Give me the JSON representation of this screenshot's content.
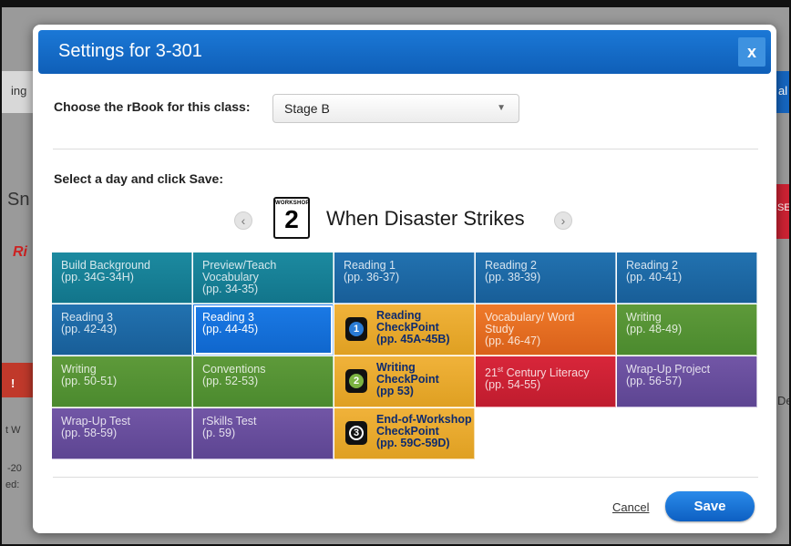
{
  "modal": {
    "title": "Settings for 3-301",
    "close_label": "x"
  },
  "rbook": {
    "label": "Choose the rBook for this class:",
    "selected": "Stage B"
  },
  "day_select": {
    "label": "Select a day and click Save:",
    "workshop_badge_small": "WORKSHOP",
    "workshop_number": "2",
    "workshop_title": "When Disaster Strikes",
    "prev_icon": "chevron-left-icon",
    "next_icon": "chevron-right-icon"
  },
  "tiles": [
    {
      "title": "Build Background",
      "pages": "(pp. 34G-34H)",
      "color": "#1c8aa0"
    },
    {
      "title": "Preview/Teach Vocabulary",
      "pages": "(pp. 34-35)",
      "color": "#1c8aa0"
    },
    {
      "title": "Reading 1",
      "pages": "(pp. 36-37)",
      "color": "#2272b0"
    },
    {
      "title": "Reading 2",
      "pages": "(pp. 38-39)",
      "color": "#2272b0"
    },
    {
      "title": "Reading 2",
      "pages": "(pp. 40-41)",
      "color": "#2272b0"
    },
    {
      "title": "Reading 3",
      "pages": "(pp. 42-43)",
      "color": "#2272b0"
    },
    {
      "title": "Reading 3",
      "pages": "(pp. 44-45)",
      "color": "#1b7ae6",
      "selected": true
    },
    {
      "title": "Reading CheckPoint",
      "pages": "(pp. 45A-45B)",
      "color": "#f0b23a",
      "checkpoint": "1"
    },
    {
      "title": "Vocabulary/ Word Study",
      "pages": "(pp. 46-47)",
      "color": "#ef7a2a"
    },
    {
      "title": "Writing",
      "pages": "(pp. 48-49)",
      "color": "#5e9a3a"
    },
    {
      "title": "Writing",
      "pages": "(pp. 50-51)",
      "color": "#5e9a3a"
    },
    {
      "title": "Conventions",
      "pages": "(pp. 52-53)",
      "color": "#5e9a3a"
    },
    {
      "title": "Writing CheckPoint",
      "pages": "(pp 53)",
      "color": "#f0b23a",
      "checkpoint": "2"
    },
    {
      "title": "21st Century Literacy",
      "pages": "(pp. 54-55)",
      "color": "#d8263a"
    },
    {
      "title": "Wrap-Up Project",
      "pages": "(pp. 56-57)",
      "color": "#7256a6"
    },
    {
      "title": "Wrap-Up Test",
      "pages": "(pp. 58-59)",
      "color": "#7256a6"
    },
    {
      "title": "rSkills Test",
      "pages": "(p. 59)",
      "color": "#7256a6"
    },
    {
      "title": "End-of-Workshop CheckPoint",
      "pages": "(pp. 59C-59D)",
      "color": "#f0b23a",
      "checkpoint": "3"
    }
  ],
  "footer": {
    "cancel_label": "Cancel",
    "save_label": "Save"
  },
  "background_fragments": [
    "ing",
    "Sn",
    "Ri",
    "al",
    "SE",
    "De",
    "t W",
    "-20",
    "ed:"
  ]
}
